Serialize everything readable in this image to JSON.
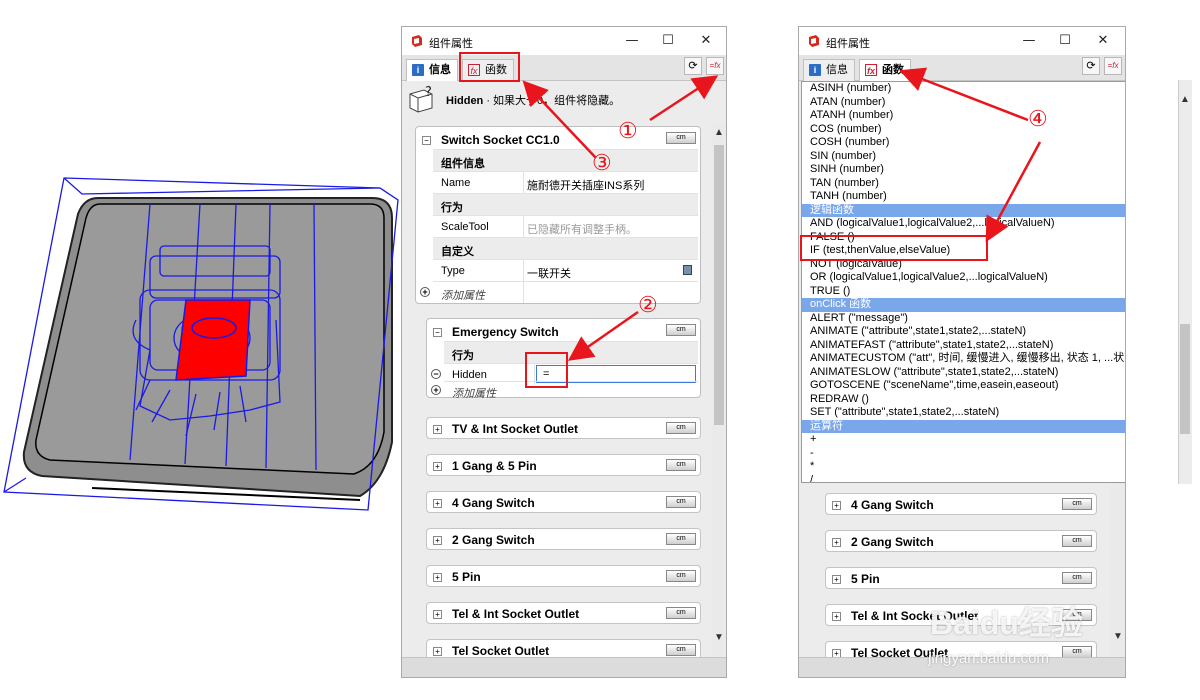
{
  "colors": {
    "annotation": "#e8161c",
    "category_bg": "#7aa6ea",
    "model_fill": "#8e8e8e",
    "wire": "#1a1ae6",
    "selected": "#ff0000"
  },
  "panel1": {
    "title": "组件属性",
    "tabs": [
      {
        "label": "信息",
        "icon": "info-icon"
      },
      {
        "label": "函数",
        "icon": "fx-icon"
      }
    ],
    "description": {
      "keyword": "Hidden",
      "text": " · 如果大于0，组件将隐藏。"
    },
    "sections": [
      {
        "title": "Switch  Socket CC1.0",
        "unit": "cm",
        "rows": [
          {
            "group": "组件信息"
          },
          {
            "key": "Name",
            "value": "施耐德开关插座INS系列"
          },
          {
            "group": "行为"
          },
          {
            "key": "ScaleTool",
            "value": "已隐藏所有调整手柄。"
          },
          {
            "group": "自定义"
          },
          {
            "key": "Type",
            "value": "一联开关"
          },
          {
            "add": "添加属性"
          }
        ]
      },
      {
        "title": "Emergency Switch",
        "unit": "cm",
        "rows": [
          {
            "group": "行为"
          },
          {
            "key": "Hidden",
            "value": "="
          },
          {
            "add": "添加属性"
          }
        ]
      }
    ],
    "collapsed": [
      "TV & Int Socket Outlet",
      "1 Gang & 5 Pin",
      "4 Gang Switch",
      "2 Gang Switch",
      "5 Pin",
      "Tel & Int Socket Outlet",
      "Tel Socket Outlet"
    ],
    "unit": "cm"
  },
  "panel2": {
    "title": "组件属性",
    "tabs": [
      {
        "label": "信息",
        "icon": "info-icon"
      },
      {
        "label": "函数",
        "icon": "fx-icon"
      }
    ],
    "functions": [
      {
        "t": "ASINH (number)"
      },
      {
        "t": "ATAN (number)"
      },
      {
        "t": "ATANH (number)"
      },
      {
        "t": "COS (number)"
      },
      {
        "t": "COSH (number)"
      },
      {
        "t": "SIN (number)"
      },
      {
        "t": "SINH (number)"
      },
      {
        "t": "TAN (number)"
      },
      {
        "t": "TANH (number)"
      },
      {
        "t": "逻辑函数",
        "cat": true
      },
      {
        "t": "AND (logicalValue1,logicalValue2,...logicalValueN)"
      },
      {
        "t": "FALSE ()"
      },
      {
        "t": "IF (test,thenValue,elseValue)"
      },
      {
        "t": "NOT (logicalValue)"
      },
      {
        "t": "OR (logicalValue1,logicalValue2,...logicalValueN)"
      },
      {
        "t": "TRUE ()"
      },
      {
        "t": "onClick 函数",
        "cat": true
      },
      {
        "t": "ALERT (\"message\")"
      },
      {
        "t": "ANIMATE (\"attribute\",state1,state2,...stateN)"
      },
      {
        "t": "ANIMATEFAST (\"attribute\",state1,state2,...stateN)"
      },
      {
        "t": "ANIMATECUSTOM (\"att\", 时间, 缓慢进入, 缓慢移出, 状态 1, ...状态 N)"
      },
      {
        "t": "ANIMATESLOW (\"attribute\",state1,state2,...stateN)"
      },
      {
        "t": "GOTOSCENE (\"sceneName\",time,easein,easeout)"
      },
      {
        "t": "REDRAW ()"
      },
      {
        "t": "SET (\"attribute\",state1,state2,...stateN)"
      },
      {
        "t": "运算符",
        "cat": true
      },
      {
        "t": "+"
      },
      {
        "t": "-"
      },
      {
        "t": "*"
      },
      {
        "t": "/"
      }
    ],
    "collapsed": [
      "4 Gang Switch",
      "2 Gang Switch",
      "5 Pin",
      "Tel & Int Socket Outlet",
      "Tel Socket Outlet"
    ],
    "unit": "cm"
  },
  "callouts": [
    "①",
    "②",
    "③",
    "④"
  ],
  "watermark": {
    "logo": "Baidu经验",
    "url": "jingyan.baidu.com"
  }
}
